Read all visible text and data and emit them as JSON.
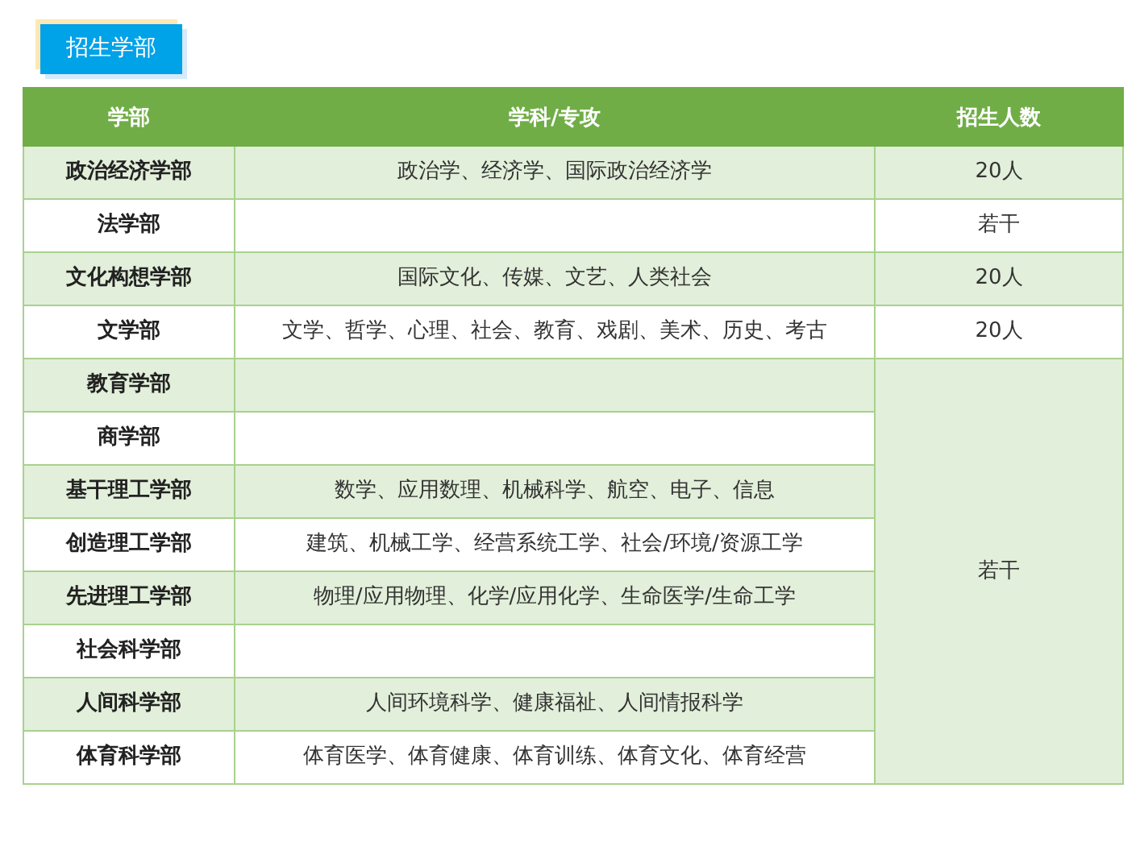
{
  "section_label": "招生学部",
  "table": {
    "columns": [
      "学部",
      "学科/专攻",
      "招生人数"
    ],
    "rows": [
      {
        "faculty": "政治经济学部",
        "subjects": "政治学、经济学、国际政治经济学",
        "count": "20人"
      },
      {
        "faculty": "法学部",
        "subjects": "",
        "count": "若干"
      },
      {
        "faculty": "文化构想学部",
        "subjects": "国际文化、传媒、文艺、人类社会",
        "count": "20人"
      },
      {
        "faculty": "文学部",
        "subjects": "文学、哲学、心理、社会、教育、戏剧、美术、历史、考古",
        "count": "20人"
      },
      {
        "faculty": "教育学部",
        "subjects": ""
      },
      {
        "faculty": "商学部",
        "subjects": ""
      },
      {
        "faculty": "基干理工学部",
        "subjects": "数学、应用数理、机械科学、航空、电子、信息"
      },
      {
        "faculty": "创造理工学部",
        "subjects": "建筑、机械工学、经营系统工学、社会/环境/资源工学"
      },
      {
        "faculty": "先进理工学部",
        "subjects": "物理/应用物理、化学/应用化学、生命医学/生命工学"
      },
      {
        "faculty": "社会科学部",
        "subjects": ""
      },
      {
        "faculty": "人间科学部",
        "subjects": "人间环境科学、健康福祉、人间情报科学"
      },
      {
        "faculty": "体育科学部",
        "subjects": "体育医学、体育健康、体育训练、体育文化、体育经营"
      }
    ],
    "shared_count": "若干"
  }
}
